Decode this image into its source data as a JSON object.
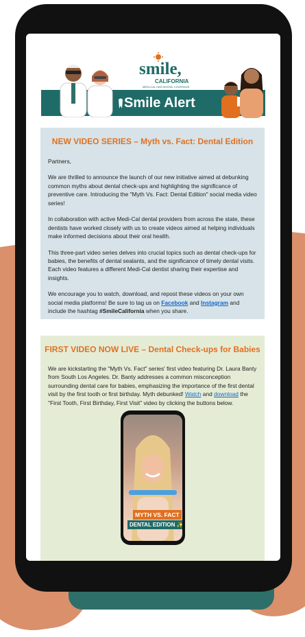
{
  "header": {
    "logo_main": "smile,",
    "logo_sub": "CALIFORNIA",
    "logo_tagline": "MEDI-CAL HAS DENTAL COVERAGE",
    "alert_title": "Smile Alert",
    "colors": {
      "brand_teal": "#1f6b67",
      "accent_orange": "#e07020"
    }
  },
  "section1": {
    "title": "NEW VIDEO SERIES – Myth vs. Fact: Dental Edition",
    "greeting": "Partners,",
    "p1": "We are thrilled to announce the launch of our new initiative aimed at debunking common myths about dental check-ups and highlighting the significance of preventive care. Introducing the \"Myth Vs. Fact: Dental Edition\" social media video series!",
    "p2": "In collaboration with active Medi-Cal dental providers from across the state, these dentists have worked closely with us to create videos aimed at helping individuals make informed decisions about their oral health.",
    "p3": "This three-part video series delves into crucial topics such as dental check-ups for babies, the benefits of dental sealants, and the significance of timely dental visits. Each video features a different Medi-Cal dentist sharing their expertise and insights.",
    "p4_before": "We encourage you to watch, download, and repost these videos on your own social media platforms! Be sure to tag us on ",
    "facebook_link": "Facebook",
    "p4_and": " and ",
    "instagram_link": "Instagram",
    "p4_mid": " and include the hashtag ",
    "hashtag": "#SmileCalifornia",
    "p4_after": " when you share."
  },
  "section2": {
    "title": "FIRST VIDEO NOW LIVE – Dental Check-ups for Babies",
    "p1_before": "We are kickstarting the \"Myth Vs. Fact\" series' first video featuring Dr. Laura Banty from South Los Angeles. Dr. Banty addresses a common misconception surrounding dental care for babies, emphasizing the importance of the first dental visit by the first tooth or first birthday. Myth debunked! ",
    "watch_link": "Watch",
    "p1_and": " and ",
    "download_link": "download",
    "p1_after": " the \"First Tooth, First Birthday, First Visit\" video by clicking the buttons below.",
    "video_badge1": "MYTH VS. FACT",
    "video_badge2": "DENTAL EDITION ✨🦷"
  }
}
